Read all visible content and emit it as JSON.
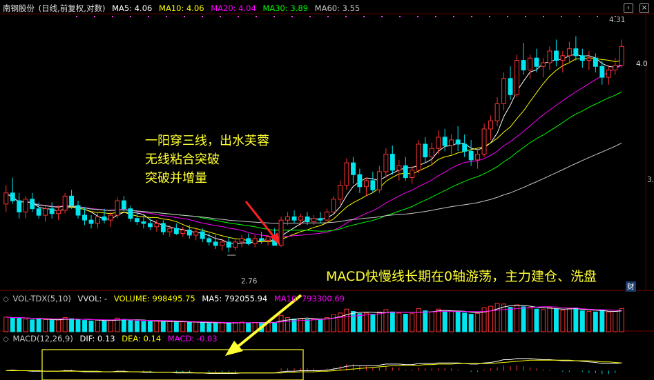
{
  "header": {
    "stock": "南钢股份",
    "mode": "(日线,前复权,对数)",
    "ma5": "MA5: 4.06",
    "ma10": "MA10: 4.06",
    "ma20": "MA20: 4.04",
    "ma30": "MA30: 3.89",
    "ma60": "MA60: 3.55"
  },
  "vol_header": {
    "name": "VOL-TDX(5,10)",
    "vvol": "VVOL: -",
    "volume": "VOLUME: 998495.75",
    "ma5": "MA5: 792055.94",
    "ma10": "MA10: 793300.69"
  },
  "macd_header": {
    "name": "MACD(12,26,9)",
    "dif": "DIF: 0.13",
    "dea": "DEA: 0.14",
    "macd": "MACD: -0.03"
  },
  "annotations": {
    "breakout_lines": [
      "一阳穿三线，出水芙蓉",
      "无线粘合突破",
      "突破并增量"
    ],
    "macd_note": "MACD快慢线长期在0轴游荡，主力建仓、洗盘"
  },
  "labels": {
    "low_price": "2.76",
    "high_price": "4.31",
    "last_price": "4.0",
    "right_axis_tick": "3.",
    "finance_tag": "财"
  },
  "colors": {
    "up": "#ff3232",
    "down": "#00e5ee",
    "ma5": "#ffffff",
    "ma10": "#ffff00",
    "ma20": "#ff00ff",
    "ma30": "#00ff00",
    "ma60": "#c8c8c8",
    "note": "#ffff33",
    "arrow_red": "#ff2020",
    "arrow_yellow": "#ffff33"
  },
  "chart_data": {
    "type": "candlestick",
    "scale": "log",
    "ylim": [
      2.6,
      4.45
    ],
    "candles": [
      [
        3.05,
        3.17,
        3.0,
        3.12
      ],
      [
        3.12,
        3.22,
        3.05,
        3.07
      ],
      [
        3.07,
        3.12,
        2.96,
        3.0
      ],
      [
        3.0,
        3.1,
        2.96,
        3.08
      ],
      [
        3.08,
        3.12,
        3.0,
        3.02
      ],
      [
        3.02,
        3.06,
        2.96,
        2.98
      ],
      [
        2.98,
        3.04,
        2.94,
        3.02
      ],
      [
        3.02,
        3.06,
        2.96,
        2.99
      ],
      [
        2.99,
        3.04,
        2.95,
        3.01
      ],
      [
        3.01,
        3.12,
        2.99,
        3.1
      ],
      [
        3.1,
        3.14,
        3.02,
        3.04
      ],
      [
        3.04,
        3.07,
        2.96,
        2.98
      ],
      [
        2.98,
        3.03,
        2.92,
        2.95
      ],
      [
        2.95,
        2.98,
        2.9,
        2.93
      ],
      [
        2.93,
        3.0,
        2.9,
        2.97
      ],
      [
        2.97,
        3.02,
        2.93,
        2.95
      ],
      [
        2.95,
        3.0,
        2.91,
        2.98
      ],
      [
        2.98,
        3.09,
        2.96,
        3.07
      ],
      [
        3.07,
        3.1,
        3.0,
        3.02
      ],
      [
        3.02,
        3.04,
        2.94,
        2.96
      ],
      [
        2.96,
        3.0,
        2.92,
        2.94
      ],
      [
        2.94,
        2.98,
        2.9,
        2.93
      ],
      [
        2.93,
        2.96,
        2.89,
        2.91
      ],
      [
        2.91,
        2.95,
        2.88,
        2.93
      ],
      [
        2.93,
        2.95,
        2.86,
        2.88
      ],
      [
        2.88,
        2.92,
        2.85,
        2.9
      ],
      [
        2.9,
        2.93,
        2.86,
        2.87
      ],
      [
        2.87,
        2.91,
        2.85,
        2.89
      ],
      [
        2.89,
        2.92,
        2.84,
        2.86
      ],
      [
        2.86,
        2.9,
        2.83,
        2.88
      ],
      [
        2.88,
        2.9,
        2.82,
        2.84
      ],
      [
        2.84,
        2.87,
        2.8,
        2.82
      ],
      [
        2.82,
        2.86,
        2.78,
        2.8
      ],
      [
        2.8,
        2.84,
        2.77,
        2.82
      ],
      [
        2.82,
        2.85,
        2.76,
        2.79
      ],
      [
        2.79,
        2.84,
        2.77,
        2.82
      ],
      [
        2.82,
        2.86,
        2.79,
        2.84
      ],
      [
        2.84,
        2.87,
        2.8,
        2.81
      ],
      [
        2.81,
        2.86,
        2.79,
        2.84
      ],
      [
        2.84,
        2.88,
        2.81,
        2.83
      ],
      [
        2.83,
        2.86,
        2.8,
        2.85
      ],
      [
        2.85,
        2.9,
        2.82,
        2.8
      ],
      [
        2.8,
        2.97,
        2.79,
        2.95
      ],
      [
        2.95,
        3.0,
        2.92,
        2.97
      ],
      [
        2.97,
        3.01,
        2.93,
        2.95
      ],
      [
        2.95,
        2.99,
        2.92,
        2.97
      ],
      [
        2.97,
        3.0,
        2.92,
        2.94
      ],
      [
        2.94,
        2.98,
        2.92,
        2.96
      ],
      [
        2.96,
        3.0,
        2.93,
        2.95
      ],
      [
        2.95,
        3.02,
        2.93,
        3.0
      ],
      [
        3.0,
        3.1,
        2.98,
        3.08
      ],
      [
        3.08,
        3.2,
        3.05,
        3.17
      ],
      [
        3.17,
        3.35,
        3.14,
        3.32
      ],
      [
        3.32,
        3.36,
        3.18,
        3.24
      ],
      [
        3.24,
        3.28,
        3.12,
        3.16
      ],
      [
        3.16,
        3.22,
        3.1,
        3.2
      ],
      [
        3.2,
        3.26,
        3.12,
        3.14
      ],
      [
        3.14,
        3.3,
        3.12,
        3.26
      ],
      [
        3.26,
        3.42,
        3.22,
        3.38
      ],
      [
        3.38,
        3.44,
        3.24,
        3.27
      ],
      [
        3.27,
        3.34,
        3.2,
        3.3
      ],
      [
        3.3,
        3.36,
        3.2,
        3.22
      ],
      [
        3.22,
        3.3,
        3.18,
        3.27
      ],
      [
        3.27,
        3.48,
        3.25,
        3.45
      ],
      [
        3.45,
        3.5,
        3.32,
        3.36
      ],
      [
        3.36,
        3.46,
        3.3,
        3.42
      ],
      [
        3.42,
        3.55,
        3.38,
        3.5
      ],
      [
        3.5,
        3.56,
        3.4,
        3.44
      ],
      [
        3.44,
        3.52,
        3.38,
        3.48
      ],
      [
        3.48,
        3.58,
        3.4,
        3.45
      ],
      [
        3.45,
        3.52,
        3.36,
        3.4
      ],
      [
        3.4,
        3.48,
        3.3,
        3.34
      ],
      [
        3.34,
        3.42,
        3.28,
        3.38
      ],
      [
        3.38,
        3.6,
        3.36,
        3.56
      ],
      [
        3.56,
        3.66,
        3.48,
        3.62
      ],
      [
        3.62,
        3.8,
        3.58,
        3.75
      ],
      [
        3.75,
        4.0,
        3.7,
        3.95
      ],
      [
        3.95,
        4.05,
        3.78,
        3.82
      ],
      [
        3.82,
        4.15,
        3.8,
        4.1
      ],
      [
        4.1,
        4.25,
        3.98,
        4.02
      ],
      [
        4.02,
        4.15,
        3.95,
        4.12
      ],
      [
        4.12,
        4.2,
        4.0,
        4.05
      ],
      [
        4.05,
        4.12,
        3.96,
        4.08
      ],
      [
        4.08,
        4.22,
        4.02,
        4.18
      ],
      [
        4.18,
        4.28,
        4.05,
        4.1
      ],
      [
        4.1,
        4.18,
        4.0,
        4.14
      ],
      [
        4.14,
        4.26,
        4.08,
        4.2
      ],
      [
        4.2,
        4.31,
        4.1,
        4.14
      ],
      [
        4.14,
        4.2,
        4.04,
        4.1
      ],
      [
        4.1,
        4.18,
        4.02,
        4.12
      ],
      [
        4.12,
        4.16,
        4.0,
        4.05
      ],
      [
        4.05,
        4.1,
        3.9,
        3.96
      ],
      [
        3.96,
        4.06,
        3.9,
        4.02
      ],
      [
        4.02,
        4.12,
        3.98,
        4.06
      ],
      [
        4.06,
        4.28,
        4.04,
        4.22
      ]
    ],
    "ma_series": [
      {
        "name": "MA5",
        "color": "#ffffff",
        "period": 5
      },
      {
        "name": "MA10",
        "color": "#ffff00",
        "period": 10
      },
      {
        "name": "MA20",
        "color": "#ff00ff",
        "period": 20
      },
      {
        "name": "MA30",
        "color": "#00ff00",
        "period": 30
      },
      {
        "name": "MA60",
        "color": "#c8c8c8",
        "period": 60
      }
    ],
    "volume": [
      0.52,
      0.48,
      0.5,
      0.45,
      0.42,
      0.44,
      0.43,
      0.4,
      0.42,
      0.5,
      0.46,
      0.42,
      0.4,
      0.38,
      0.41,
      0.39,
      0.4,
      0.48,
      0.44,
      0.4,
      0.38,
      0.37,
      0.36,
      0.38,
      0.35,
      0.36,
      0.34,
      0.35,
      0.33,
      0.34,
      0.32,
      0.3,
      0.31,
      0.32,
      0.3,
      0.33,
      0.34,
      0.31,
      0.33,
      0.32,
      0.34,
      0.33,
      0.58,
      0.5,
      0.45,
      0.47,
      0.43,
      0.45,
      0.44,
      0.5,
      0.6,
      0.66,
      0.8,
      0.72,
      0.64,
      0.66,
      0.62,
      0.7,
      0.78,
      0.7,
      0.66,
      0.62,
      0.64,
      0.82,
      0.74,
      0.7,
      0.8,
      0.72,
      0.74,
      0.7,
      0.66,
      0.62,
      0.65,
      0.85,
      0.9,
      1.0,
      0.98,
      0.86,
      0.95,
      0.88,
      0.84,
      0.8,
      0.78,
      0.86,
      0.8,
      0.76,
      0.82,
      0.84,
      0.74,
      0.72,
      0.7,
      0.76,
      0.7,
      0.72,
      0.82
    ],
    "macd_dif": [
      0.0,
      0.01,
      0.0,
      0.0,
      -0.01,
      -0.01,
      -0.01,
      -0.01,
      -0.01,
      0.0,
      0.0,
      -0.01,
      -0.02,
      -0.02,
      -0.02,
      -0.02,
      -0.02,
      -0.01,
      -0.01,
      -0.02,
      -0.02,
      -0.03,
      -0.03,
      -0.03,
      -0.03,
      -0.03,
      -0.04,
      -0.04,
      -0.04,
      -0.04,
      -0.04,
      -0.05,
      -0.05,
      -0.05,
      -0.05,
      -0.05,
      -0.04,
      -0.04,
      -0.04,
      -0.04,
      -0.04,
      -0.04,
      -0.02,
      -0.01,
      -0.01,
      0.0,
      0.0,
      0.0,
      0.0,
      0.01,
      0.03,
      0.05,
      0.08,
      0.09,
      0.09,
      0.09,
      0.09,
      0.1,
      0.12,
      0.12,
      0.12,
      0.11,
      0.11,
      0.13,
      0.13,
      0.13,
      0.14,
      0.14,
      0.14,
      0.14,
      0.13,
      0.12,
      0.12,
      0.14,
      0.15,
      0.17,
      0.2,
      0.2,
      0.22,
      0.22,
      0.22,
      0.21,
      0.2,
      0.2,
      0.19,
      0.18,
      0.18,
      0.18,
      0.17,
      0.16,
      0.15,
      0.13,
      0.13,
      0.13,
      0.14
    ],
    "macd_dea": [
      0.0,
      0.0,
      0.0,
      0.0,
      0.0,
      0.0,
      -0.01,
      -0.01,
      -0.01,
      -0.01,
      -0.01,
      -0.01,
      -0.01,
      -0.01,
      -0.01,
      -0.02,
      -0.02,
      -0.02,
      -0.02,
      -0.02,
      -0.02,
      -0.02,
      -0.02,
      -0.03,
      -0.03,
      -0.03,
      -0.03,
      -0.03,
      -0.03,
      -0.04,
      -0.04,
      -0.04,
      -0.04,
      -0.04,
      -0.04,
      -0.04,
      -0.04,
      -0.04,
      -0.04,
      -0.04,
      -0.04,
      -0.04,
      -0.04,
      -0.03,
      -0.03,
      -0.02,
      -0.02,
      -0.02,
      -0.01,
      -0.01,
      0.0,
      0.01,
      0.02,
      0.03,
      0.04,
      0.05,
      0.06,
      0.07,
      0.08,
      0.09,
      0.09,
      0.1,
      0.1,
      0.1,
      0.11,
      0.11,
      0.12,
      0.12,
      0.12,
      0.13,
      0.13,
      0.13,
      0.13,
      0.13,
      0.13,
      0.14,
      0.15,
      0.16,
      0.17,
      0.18,
      0.19,
      0.19,
      0.19,
      0.19,
      0.19,
      0.19,
      0.19,
      0.18,
      0.18,
      0.18,
      0.17,
      0.16,
      0.16,
      0.15,
      0.14
    ]
  }
}
